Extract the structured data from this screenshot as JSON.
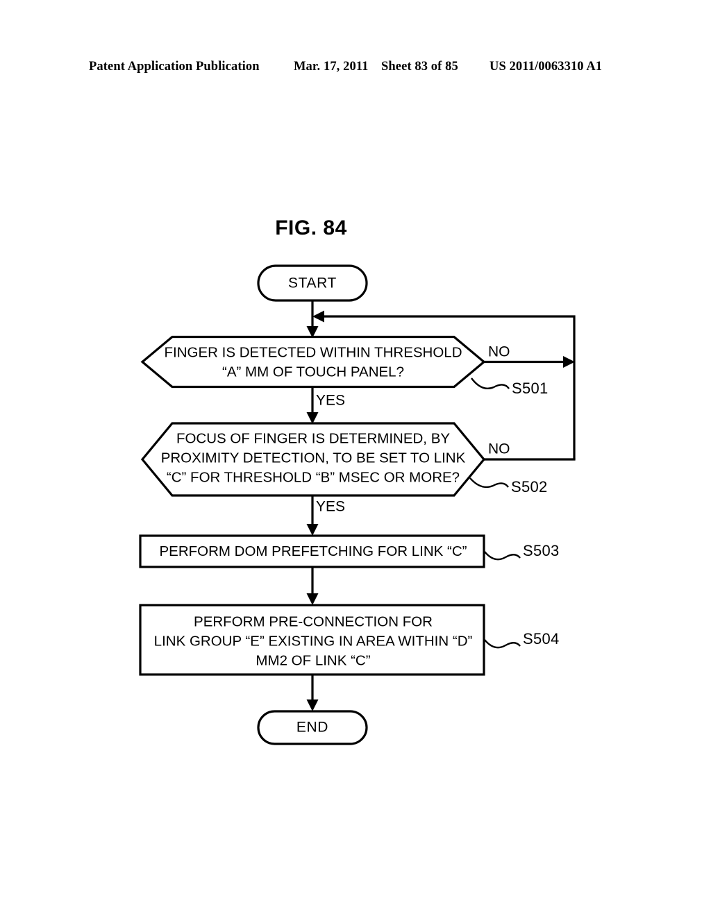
{
  "header": {
    "publication": "Patent Application Publication",
    "date": "Mar. 17, 2011",
    "sheet": "Sheet 83 of 85",
    "number": "US 2011/0063310 A1"
  },
  "figure": {
    "title": "FIG. 84"
  },
  "flowchart": {
    "start": {
      "label": "START"
    },
    "end": {
      "label": "END"
    },
    "steps": [
      {
        "ref": "S501",
        "type": "decision",
        "lines": [
          "FINGER IS DETECTED WITHIN THRESHOLD",
          "“A” MM OF TOUCH PANEL?"
        ],
        "yes_label": "YES",
        "no_label": "NO"
      },
      {
        "ref": "S502",
        "type": "decision",
        "lines": [
          "FOCUS OF FINGER IS DETERMINED, BY",
          "PROXIMITY DETECTION, TO BE SET TO LINK",
          "“C” FOR THRESHOLD “B” MSEC OR MORE?"
        ],
        "yes_label": "YES",
        "no_label": "NO"
      },
      {
        "ref": "S503",
        "type": "process",
        "lines": [
          "PERFORM DOM PREFETCHING FOR LINK “C”"
        ]
      },
      {
        "ref": "S504",
        "type": "process",
        "lines": [
          "PERFORM PRE-CONNECTION FOR",
          "LINK GROUP “E” EXISTING IN AREA WITHIN “D”",
          "MM2 OF LINK “C”"
        ]
      }
    ]
  },
  "colors": {
    "ink": "#000000",
    "paper": "#ffffff"
  }
}
